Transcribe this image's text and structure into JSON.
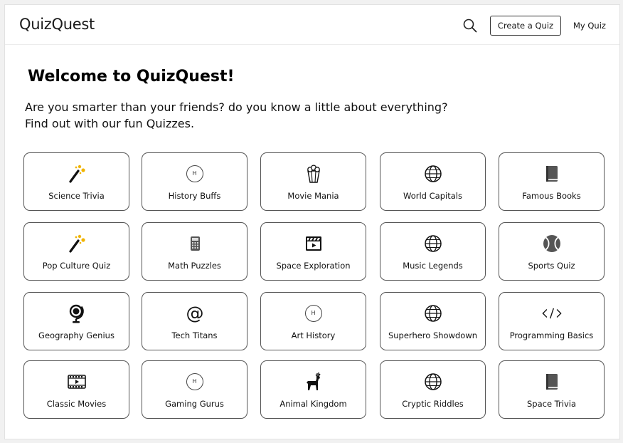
{
  "app": {
    "title": "QuizQuest"
  },
  "header": {
    "search_icon": "search-icon",
    "create_label": "Create a Quiz",
    "my_quiz_label": "My Quiz"
  },
  "main": {
    "welcome": "Welcome to QuizQuest!",
    "intro_line1": "Are you smarter than your friends? do you know a little about everything?",
    "intro_line2": "Find out with our fun Quizzes."
  },
  "colors": {
    "accent_gold": "#f0b400",
    "border": "#555555"
  },
  "quizzes": [
    {
      "label": "Science Trivia",
      "icon": "magic-wand"
    },
    {
      "label": "History Buffs",
      "icon": "h-circle",
      "icon_text": "H"
    },
    {
      "label": "Movie Mania",
      "icon": "popcorn"
    },
    {
      "label": "World Capitals",
      "icon": "globe"
    },
    {
      "label": "Famous Books",
      "icon": "book"
    },
    {
      "label": "Pop Culture Quiz",
      "icon": "magic-wand"
    },
    {
      "label": "Math Puzzles",
      "icon": "calculator"
    },
    {
      "label": "Space Exploration",
      "icon": "clapperboard"
    },
    {
      "label": "Music Legends",
      "icon": "globe"
    },
    {
      "label": "Sports Quiz",
      "icon": "tennis-ball"
    },
    {
      "label": "Geography Genius",
      "icon": "desk-globe"
    },
    {
      "label": "Tech Titans",
      "icon": "at-sign"
    },
    {
      "label": "Art History",
      "icon": "h-circle",
      "icon_text": "H"
    },
    {
      "label": "Superhero Showdown",
      "icon": "globe"
    },
    {
      "label": "Programming Basics",
      "icon": "code"
    },
    {
      "label": "Classic Movies",
      "icon": "film"
    },
    {
      "label": "Gaming Gurus",
      "icon": "h-circle",
      "icon_text": "H"
    },
    {
      "label": "Animal Kingdom",
      "icon": "deer"
    },
    {
      "label": "Cryptic Riddles",
      "icon": "globe"
    },
    {
      "label": "Space Trivia",
      "icon": "book"
    }
  ]
}
